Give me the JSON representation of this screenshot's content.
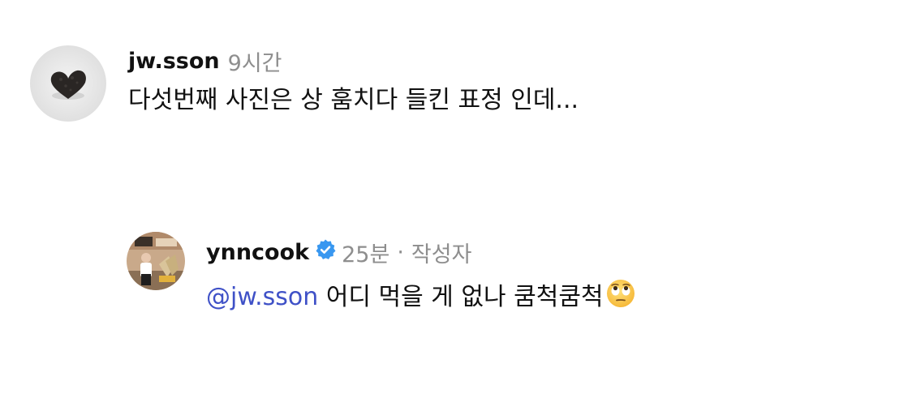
{
  "comments": [
    {
      "username": "jw.sson",
      "time": "9시간",
      "text": "다섯번째 사진은 상 훔치다 들킨 표정 인데...",
      "avatar_icon": "heart-shaped-food-avatar"
    },
    {
      "username": "ynncook",
      "verified": true,
      "time": "25분",
      "separator": "·",
      "author_badge": "작성자",
      "mention": "@jw.sson",
      "text": " 어디 먹을 게 없나 쿰척쿰척",
      "emoji_icon": "face-with-rolling-eyes-icon",
      "avatar_icon": "photo-avatar"
    }
  ],
  "colors": {
    "mention": "#3f51c7",
    "meta": "#8e8e8e",
    "verified": "#3897f0"
  }
}
